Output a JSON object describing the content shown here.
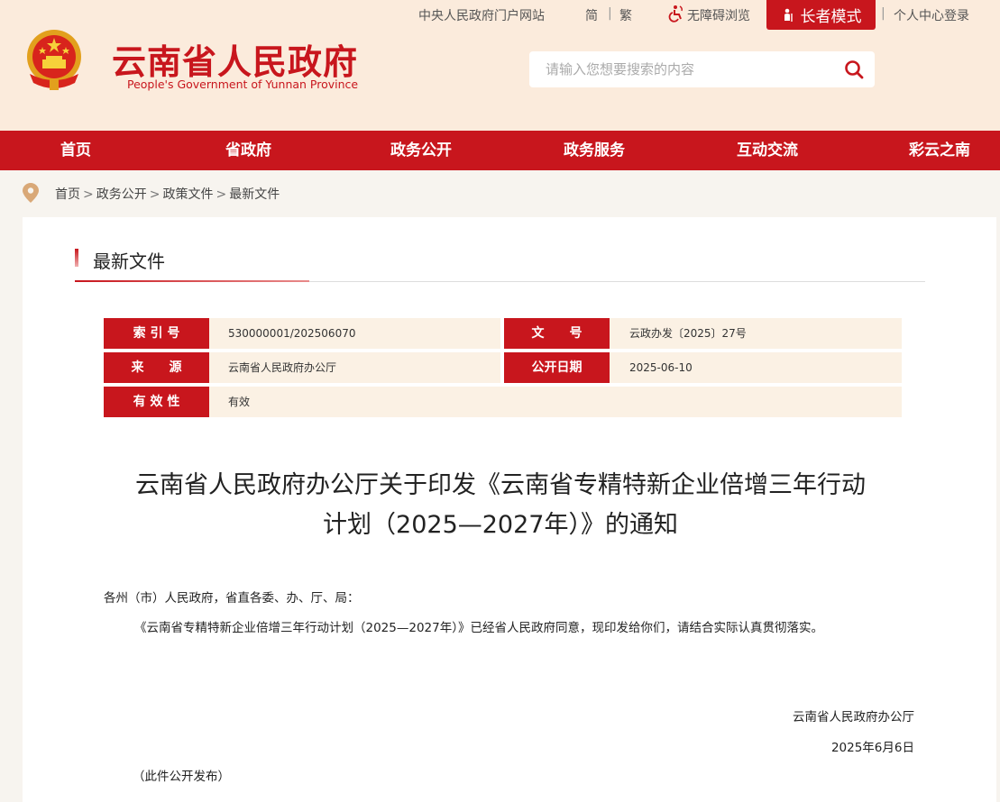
{
  "toplinks": {
    "portal": "中央人民政府门户网站",
    "simplified": "简",
    "separator": "|",
    "traditional": "繁",
    "accessible": "无障碍浏览",
    "elder_mode": "长者模式",
    "user_center": "个人中心登录"
  },
  "brand": {
    "name_cn": "云南省人民政府",
    "name_en": "People's Government of Yunnan Province"
  },
  "search": {
    "placeholder": "请输入您想要搜索的内容"
  },
  "nav": {
    "items": [
      "首页",
      "省政府",
      "政务公开",
      "政务服务",
      "互动交流",
      "彩云之南"
    ]
  },
  "breadcrumb": {
    "items": [
      "首页",
      "政务公开",
      "政策文件",
      "最新文件"
    ],
    "separator": ">"
  },
  "section": {
    "title": "最新文件"
  },
  "meta": {
    "index_label": "索 引 号",
    "index_value": "530000001/202506070",
    "docno_label": "文　　号",
    "docno_value": "云政办发〔2025〕27号",
    "source_label": "来　　源",
    "source_value": "云南省人民政府办公厅",
    "date_label": "公开日期",
    "date_value": "2025-06-10",
    "validity_label": "有 效 性",
    "validity_value": "有效"
  },
  "document": {
    "title_line1": "云南省人民政府办公厅关于印发《云南省专精特新企业倍增三年行动",
    "title_line2": "计划（2025—2027年）》的通知",
    "salutation": "各州（市）人民政府，省直各委、办、厅、局：",
    "paragraph": "《云南省专精特新企业倍增三年行动计划（2025—2027年）》已经省人民政府同意，现印发给你们，请结合实际认真贯彻落实。",
    "signature": "云南省人民政府办公厅",
    "date": "2025年6月6日",
    "note": "（此件公开发布）"
  },
  "colors": {
    "primary_red": "#c8161d",
    "header_bg": "#fbebdc",
    "meta_bg": "#fbf1e4",
    "page_bg": "#f7f4ef"
  },
  "icons": {
    "emblem": "national-emblem",
    "accessible": "wheelchair-icon",
    "elder": "elder-person-icon",
    "search": "search-icon",
    "location": "location-pin-icon"
  }
}
